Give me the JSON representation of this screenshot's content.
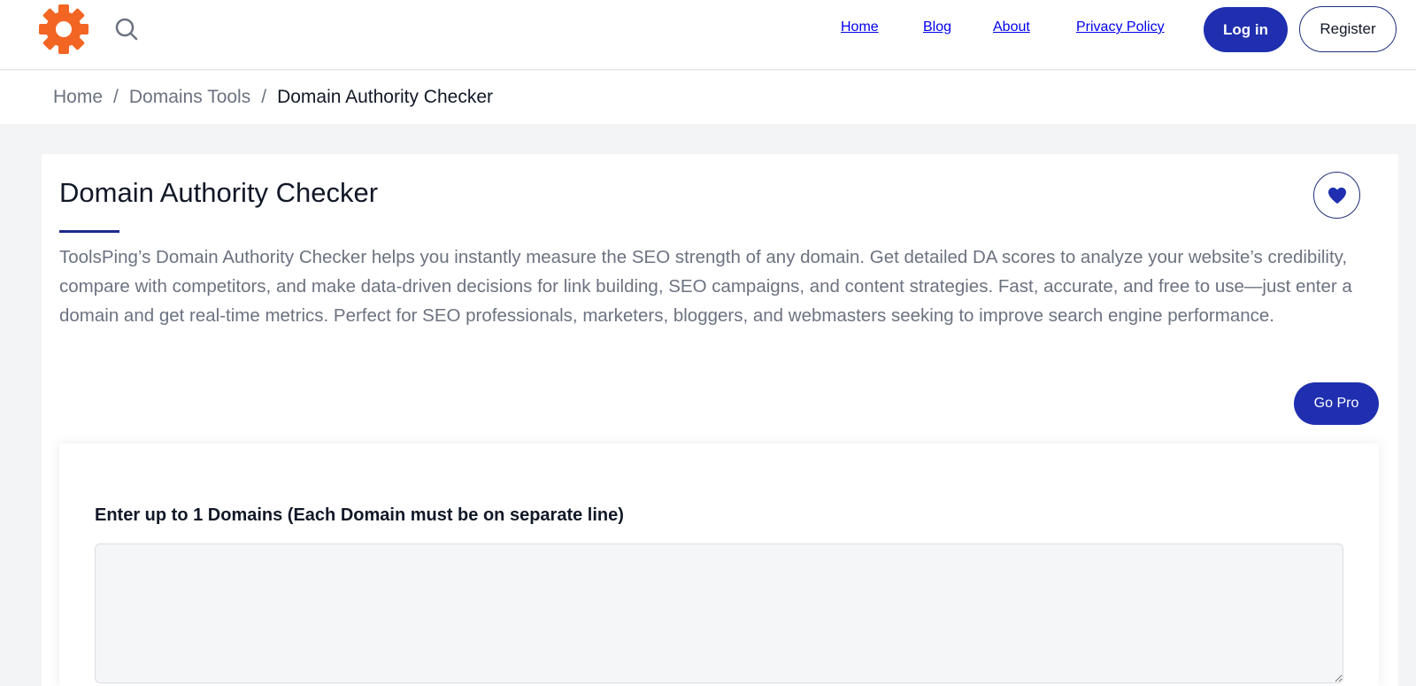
{
  "header": {
    "logo_icon": "gear-logo-icon",
    "logo_color": "#f26522",
    "search_icon": "search-icon",
    "nav": [
      {
        "label": "Home"
      },
      {
        "label": "Blog"
      },
      {
        "label": "About"
      },
      {
        "label": "Privacy Policy"
      }
    ],
    "login_label": "Log in",
    "register_label": "Register",
    "accent_color": "#1f2fb0"
  },
  "breadcrumb": {
    "items": [
      "Home",
      "Domains Tools"
    ],
    "separator": "/",
    "current": "Domain Authority Checker"
  },
  "main": {
    "title": "Domain Authority Checker",
    "favorite_icon": "heart-icon",
    "description": "ToolsPing’s Domain Authority Checker helps you instantly measure the SEO strength of any domain. Get detailed DA scores to analyze your website’s credibility, compare with competitors, and make data-driven decisions for link building, SEO campaigns, and content strategies. Fast, accurate, and free to use—just enter a domain and get real-time metrics. Perfect for SEO professionals, marketers, bloggers, and webmasters seeking to improve search engine performance.",
    "go_pro_label": "Go Pro",
    "form": {
      "label": "Enter up to 1 Domains (Each Domain must be on separate line)",
      "value": "",
      "placeholder": ""
    }
  }
}
